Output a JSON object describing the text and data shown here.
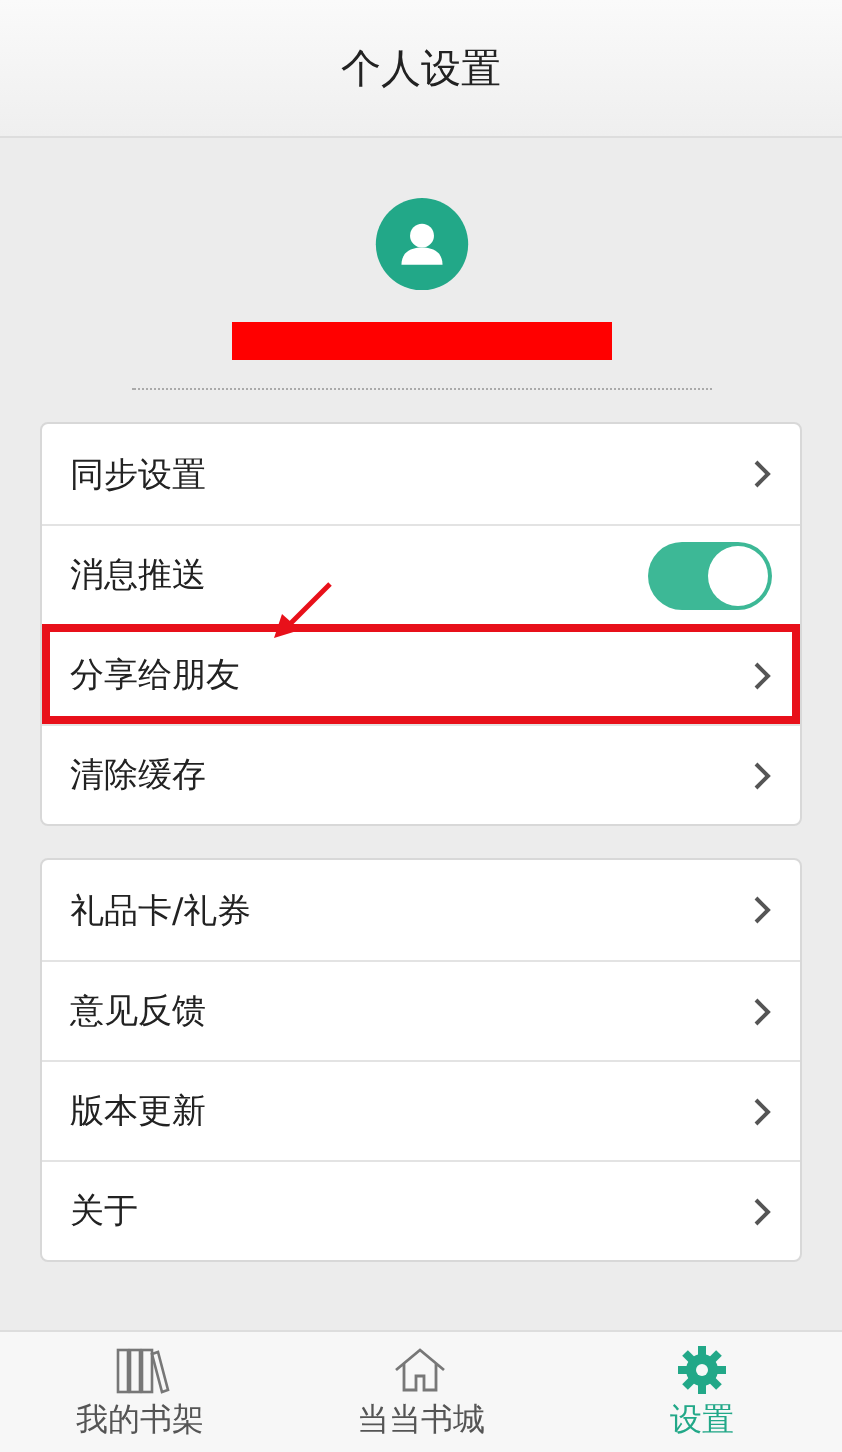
{
  "header": {
    "title": "个人设置"
  },
  "profile": {
    "name_redacted": true
  },
  "groups": [
    {
      "items": [
        {
          "label": "同步设置",
          "kind": "link",
          "highlighted": false
        },
        {
          "label": "消息推送",
          "kind": "toggle",
          "on": true,
          "highlighted": false
        },
        {
          "label": "分享给朋友",
          "kind": "link",
          "highlighted": true
        },
        {
          "label": "清除缓存",
          "kind": "link",
          "highlighted": false
        }
      ]
    },
    {
      "items": [
        {
          "label": "礼品卡/礼券",
          "kind": "link",
          "highlighted": false
        },
        {
          "label": "意见反馈",
          "kind": "link",
          "highlighted": false
        },
        {
          "label": "版本更新",
          "kind": "link",
          "highlighted": false
        },
        {
          "label": "关于",
          "kind": "link",
          "highlighted": false
        }
      ]
    }
  ],
  "tabs": [
    {
      "label": "我的书架",
      "kind": "books",
      "selected": false
    },
    {
      "label": "当当书城",
      "kind": "home",
      "selected": false
    },
    {
      "label": "设置",
      "kind": "gear",
      "selected": true
    }
  ]
}
